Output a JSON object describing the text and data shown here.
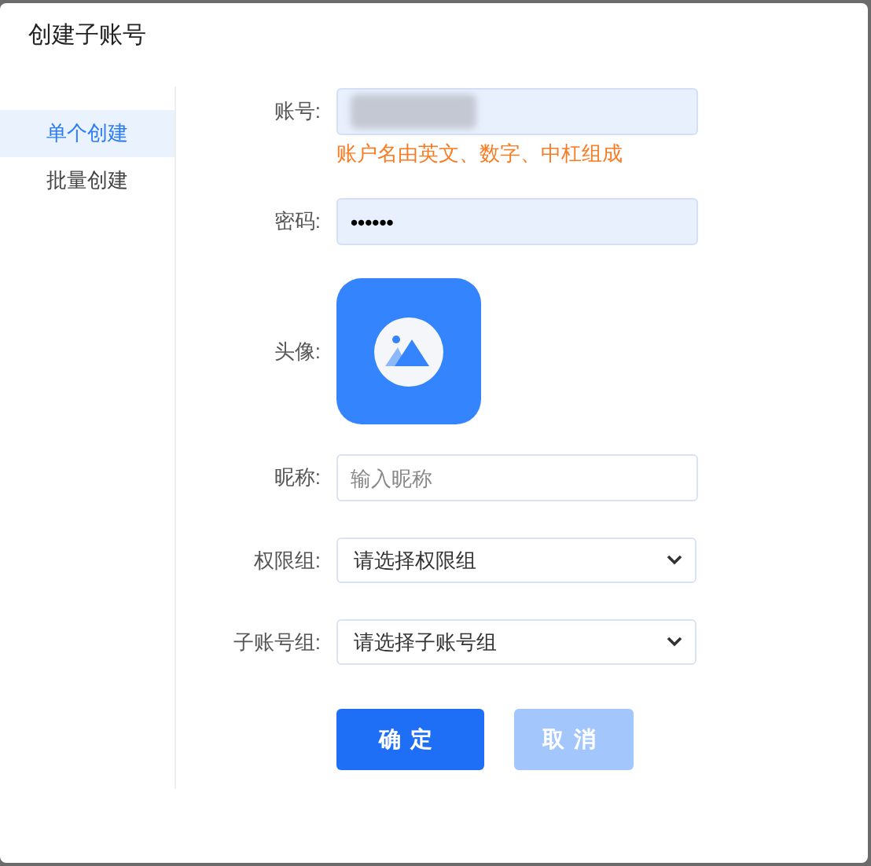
{
  "dialog": {
    "title": "创建子账号"
  },
  "sidebar": {
    "items": [
      {
        "label": "单个创建",
        "selected": true
      },
      {
        "label": "批量创建",
        "selected": false
      }
    ]
  },
  "form": {
    "fields": [
      {
        "kind": "redacted",
        "label": "账号:",
        "hint": "账户名由英文、数字、中杠组成"
      },
      {
        "kind": "text",
        "label": "密码:",
        "value": "••••••"
      },
      {
        "kind": "avatar",
        "label": "头像:"
      },
      {
        "kind": "text",
        "label": "昵称:",
        "placeholder": "输入昵称"
      },
      {
        "kind": "select",
        "label": "权限组:",
        "value": "请选择权限组"
      },
      {
        "kind": "select",
        "label": "子账号组:",
        "value": "请选择子账号组"
      }
    ]
  },
  "buttons": [
    {
      "label": "确定",
      "disabled": false
    },
    {
      "label": "取消",
      "disabled": true
    }
  ]
}
